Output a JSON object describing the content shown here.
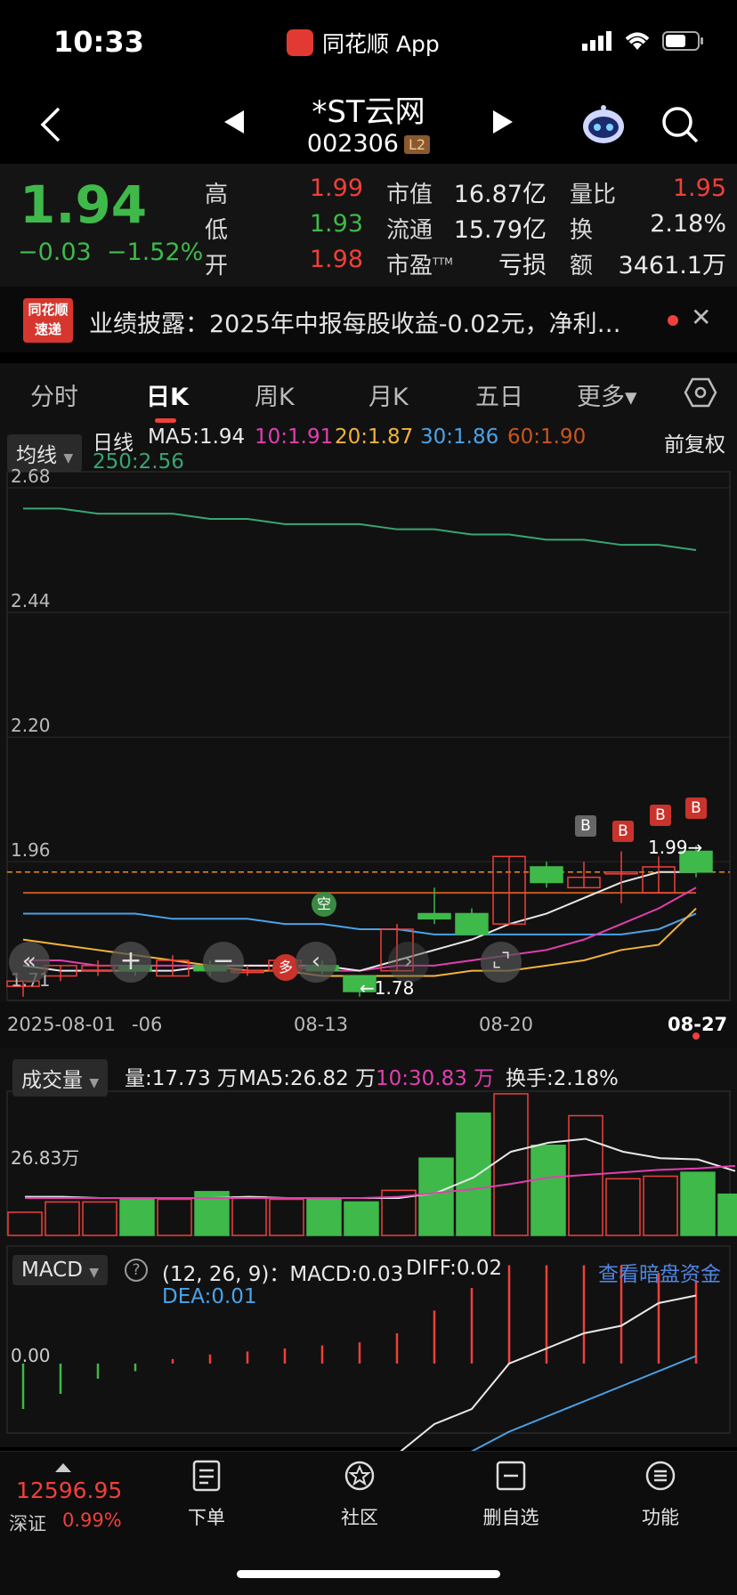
{
  "status": {
    "time": "10:33",
    "app_name": "同花顺 App"
  },
  "header": {
    "name": "*ST云网",
    "code": "002306",
    "level": "L2"
  },
  "quote": {
    "price": "1.94",
    "change": "−0.03",
    "change_pct": "−1.52%",
    "high_label": "高",
    "high": "1.99",
    "low_label": "低",
    "low": "1.93",
    "open_label": "开",
    "open": "1.98",
    "mktcap_label": "市值",
    "mktcap": "16.87亿",
    "float_label": "流通",
    "float": "15.79亿",
    "pe_label": "市盈",
    "pe_sup": "TTM",
    "pe": "亏损",
    "volratio_label": "量比",
    "volratio": "1.95",
    "turnover_label": "换",
    "turnover": "2.18%",
    "amount_label": "额",
    "amount": "3461.1万"
  },
  "news": {
    "logo_top": "同花顺",
    "logo_bottom": "速递",
    "text": "业绩披露：2025年中报每股收益-0.02元，净利…"
  },
  "tabs": [
    "分时",
    "日K",
    "周K",
    "月K",
    "五日",
    "更多▾"
  ],
  "kline": {
    "selector": "均线",
    "period": "日线",
    "ma5": "MA5:1.94",
    "ma10": "10:1.91",
    "ma20": "20:1.87",
    "ma30": "30:1.86",
    "ma60": "60:1.90",
    "ma250": "250:2.56",
    "adjust": "前复权",
    "y_ticks": [
      "2.68",
      "2.44",
      "2.20",
      "1.96",
      "1.71"
    ],
    "x_ticks": [
      "2025-08-01",
      "-06",
      "08-13",
      "08-20",
      "08-27"
    ],
    "hi_label": "1.99→",
    "lo_label": "←1.78",
    "b_marker": "B",
    "kong": "空",
    "duo": "多"
  },
  "volume": {
    "selector": "成交量",
    "vol": "量:17.73 万",
    "ma5": "MA5:26.82 万",
    "ma10": "10:30.83 万",
    "turnover": "换手:2.18%",
    "y_tick": "26.83万"
  },
  "macd": {
    "selector": "MACD",
    "params": "(12, 26, 9)：MACD:0.03",
    "diff": "DIFF:0.02",
    "dea": "DEA:0.01",
    "link": "查看暗盘资金",
    "y_tick": "0.00"
  },
  "chart_data": {
    "type": "candlestick",
    "dates": [
      "08-01",
      "08-04",
      "08-05",
      "08-06",
      "08-07",
      "08-08",
      "08-11",
      "08-12",
      "08-13",
      "08-14",
      "08-15",
      "08-18",
      "08-19",
      "08-20",
      "08-21",
      "08-22",
      "08-25",
      "08-26",
      "08-27"
    ],
    "candles": [
      {
        "o": 1.72,
        "c": 1.73,
        "h": 1.73,
        "l": 1.7
      },
      {
        "o": 1.74,
        "c": 1.76,
        "h": 1.76,
        "l": 1.73
      },
      {
        "o": 1.75,
        "c": 1.76,
        "h": 1.77,
        "l": 1.74
      },
      {
        "o": 1.76,
        "c": 1.75,
        "h": 1.76,
        "l": 1.74
      },
      {
        "o": 1.74,
        "c": 1.77,
        "h": 1.78,
        "l": 1.74
      },
      {
        "o": 1.76,
        "c": 1.75,
        "h": 1.77,
        "l": 1.74
      },
      {
        "o": 1.75,
        "c": 1.75,
        "h": 1.76,
        "l": 1.74
      },
      {
        "o": 1.75,
        "c": 1.77,
        "h": 1.77,
        "l": 1.74
      },
      {
        "o": 1.76,
        "c": 1.75,
        "h": 1.77,
        "l": 1.74
      },
      {
        "o": 1.74,
        "c": 1.71,
        "h": 1.74,
        "l": 1.7
      },
      {
        "o": 1.75,
        "c": 1.83,
        "h": 1.84,
        "l": 1.75
      },
      {
        "o": 1.86,
        "c": 1.85,
        "h": 1.91,
        "l": 1.84
      },
      {
        "o": 1.86,
        "c": 1.82,
        "h": 1.87,
        "l": 1.82
      },
      {
        "o": 1.84,
        "c": 1.97,
        "h": 1.97,
        "l": 1.84
      },
      {
        "o": 1.95,
        "c": 1.92,
        "h": 1.96,
        "l": 1.91
      },
      {
        "o": 1.91,
        "c": 1.93,
        "h": 1.96,
        "l": 1.91
      },
      {
        "o": 1.94,
        "c": 1.94,
        "h": 1.98,
        "l": 1.88
      },
      {
        "o": 1.9,
        "c": 1.95,
        "h": 1.97,
        "l": 1.9
      },
      {
        "o": 1.98,
        "c": 1.94,
        "h": 1.99,
        "l": 1.93
      }
    ],
    "ma5": [
      1.76,
      1.75,
      1.75,
      1.75,
      1.75,
      1.76,
      1.76,
      1.76,
      1.76,
      1.75,
      1.77,
      1.79,
      1.81,
      1.84,
      1.86,
      1.89,
      1.92,
      1.94,
      1.94
    ],
    "ma10": [
      1.77,
      1.77,
      1.76,
      1.76,
      1.76,
      1.76,
      1.76,
      1.76,
      1.75,
      1.75,
      1.76,
      1.76,
      1.77,
      1.78,
      1.79,
      1.81,
      1.84,
      1.87,
      1.91
    ],
    "ma20": [
      1.81,
      1.8,
      1.79,
      1.78,
      1.77,
      1.76,
      1.75,
      1.75,
      1.74,
      1.74,
      1.74,
      1.74,
      1.75,
      1.75,
      1.76,
      1.77,
      1.79,
      1.8,
      1.87
    ],
    "ma30": [
      1.86,
      1.86,
      1.86,
      1.86,
      1.85,
      1.85,
      1.85,
      1.84,
      1.84,
      1.83,
      1.83,
      1.82,
      1.82,
      1.82,
      1.82,
      1.82,
      1.82,
      1.83,
      1.86
    ],
    "ma60": [
      1.9,
      1.9,
      1.9,
      1.9,
      1.9,
      1.9,
      1.9,
      1.9,
      1.9,
      1.9,
      1.9,
      1.9,
      1.9,
      1.9,
      1.9,
      1.9,
      1.9,
      1.9,
      1.9
    ],
    "ma250": [
      2.64,
      2.64,
      2.63,
      2.63,
      2.63,
      2.62,
      2.62,
      2.61,
      2.61,
      2.61,
      2.6,
      2.6,
      2.59,
      2.59,
      2.58,
      2.58,
      2.57,
      2.57,
      2.56
    ],
    "y_range": [
      1.71,
      2.68
    ],
    "volume": [
      18,
      26,
      26,
      28,
      28,
      34,
      30,
      28,
      28,
      26,
      35,
      60,
      95,
      110,
      70,
      93,
      44,
      46,
      49,
      32
    ],
    "volume_ma5": [
      30,
      30,
      29,
      29,
      29,
      29,
      30,
      29,
      29,
      29,
      29,
      33,
      45,
      65,
      72,
      75,
      65,
      60,
      59,
      50
    ],
    "volume_ma10": [
      29,
      29,
      29,
      29,
      29,
      29,
      29,
      29,
      29,
      29,
      30,
      33,
      36,
      40,
      45,
      47,
      49,
      51,
      52,
      54
    ],
    "macd_hist": [
      -0.03,
      -0.02,
      -0.01,
      -0.005,
      0.003,
      0.006,
      0.008,
      0.01,
      0.012,
      0.014,
      0.02,
      0.035,
      0.05,
      0.065,
      0.065,
      0.065,
      0.065,
      0.06,
      0.055
    ],
    "macd_diff": [
      -0.095,
      -0.092,
      -0.09,
      -0.09,
      -0.085,
      -0.082,
      -0.08,
      -0.078,
      -0.075,
      -0.074,
      -0.06,
      -0.04,
      -0.03,
      0.0,
      0.01,
      0.02,
      0.025,
      0.04,
      0.045
    ],
    "macd_dea": [
      -0.085,
      -0.086,
      -0.087,
      -0.087,
      -0.086,
      -0.085,
      -0.084,
      -0.082,
      -0.08,
      -0.079,
      -0.075,
      -0.068,
      -0.058,
      -0.045,
      -0.035,
      -0.025,
      -0.015,
      -0.005,
      0.005
    ]
  },
  "bottom": {
    "index_value": "12596.95",
    "index_name": "深证",
    "index_pct": "0.99%",
    "nav": [
      "下单",
      "社区",
      "删自选",
      "功能"
    ]
  }
}
